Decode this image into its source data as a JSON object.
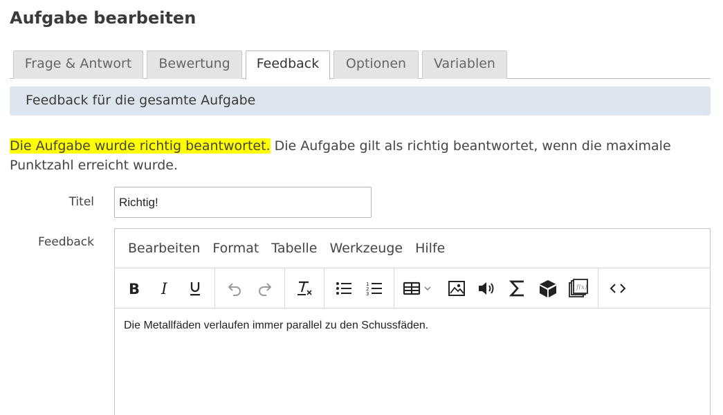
{
  "page": {
    "title": "Aufgabe bearbeiten"
  },
  "tabs": [
    {
      "label": "Frage & Antwort",
      "active": false
    },
    {
      "label": "Bewertung",
      "active": false
    },
    {
      "label": "Feedback",
      "active": true
    },
    {
      "label": "Optionen",
      "active": false
    },
    {
      "label": "Variablen",
      "active": false
    }
  ],
  "section": {
    "header": "Feedback für die gesamte Aufgabe"
  },
  "info": {
    "highlight": "Die Aufgabe wurde richtig beantwortet.",
    "text": " Die Aufgabe gilt als richtig beantwortet, wenn die maximale Punktzahl erreicht wurde."
  },
  "form": {
    "title_label": "Titel",
    "title_value": "Richtig!",
    "feedback_label": "Feedback"
  },
  "editor": {
    "menu": [
      "Bearbeiten",
      "Format",
      "Tabelle",
      "Werkzeuge",
      "Hilfe"
    ],
    "toolbar_icons": [
      "bold-icon",
      "italic-icon",
      "underline-icon",
      "undo-icon",
      "redo-icon",
      "clear-formatting-icon",
      "bullet-list-icon",
      "numbered-list-icon",
      "table-icon",
      "image-icon",
      "audio-icon",
      "formula-icon",
      "3d-object-icon",
      "media-gallery-icon",
      "source-code-icon"
    ],
    "content": "Die Metallfäden verlaufen immer parallel zu den Schussfäden."
  },
  "colors": {
    "highlight": "#ffff00",
    "section_header_bg": "#dde6ee",
    "tab_inactive_bg": "#e4e4e4"
  }
}
